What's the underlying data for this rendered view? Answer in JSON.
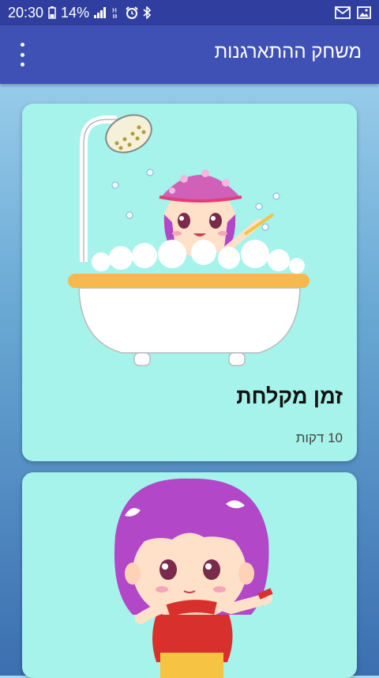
{
  "status_bar": {
    "time": "20:30",
    "battery": "14%",
    "icons": [
      "battery-icon",
      "signal-icon",
      "h-network-icon",
      "alarm-icon",
      "bluetooth-icon",
      "gmail-icon",
      "gallery-icon"
    ]
  },
  "app_bar": {
    "title": "משחק ההתארגנות",
    "menu_icon": "overflow-menu-icon"
  },
  "cards": [
    {
      "title": "זמן מקלחת",
      "subtitle": "10 דקות",
      "image": "girl-in-bathtub-illustration"
    },
    {
      "title": "",
      "subtitle": "",
      "image": "girl-stretching-illustration"
    }
  ],
  "colors": {
    "status_bar": "#303f9f",
    "app_bar": "#3f51b5",
    "card_bg": "#a5f3ea"
  }
}
